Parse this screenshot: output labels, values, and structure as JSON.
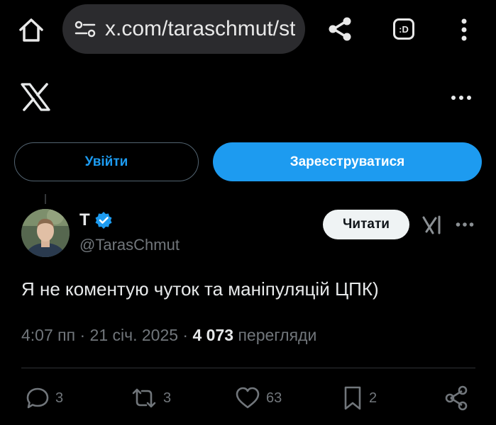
{
  "browser": {
    "url": "x.com/taraschmut/st",
    "icons": {
      "home": "home-icon",
      "site_settings": "site-settings-icon",
      "share": "share-icon",
      "desktop_site": "desktop-site-icon",
      "menu": "more-vertical-icon"
    },
    "desktop_label": ":D"
  },
  "header": {
    "logo": "x-logo-icon",
    "more": "more-horizontal-icon"
  },
  "auth": {
    "login_label": "Увійти",
    "signup_label": "Зареєструватися"
  },
  "tweet": {
    "display_name": "T",
    "verified": true,
    "handle": "@TarasChmut",
    "follow_label": "Читати",
    "text": "Я не коментую чуток та маніпуляцій ЦПК)",
    "time": "4:07 пп",
    "separator": " · ",
    "date": "21 січ. 2025",
    "views_count": "4 073",
    "views_label": "перегляди",
    "stats": {
      "replies": "3",
      "reposts": "3",
      "likes": "63",
      "bookmarks": "2"
    }
  },
  "colors": {
    "background": "#000000",
    "accent": "#1d9bf0",
    "text_primary": "#e7e9ea",
    "text_secondary": "#71767b",
    "url_bar": "#2b2b2e"
  }
}
